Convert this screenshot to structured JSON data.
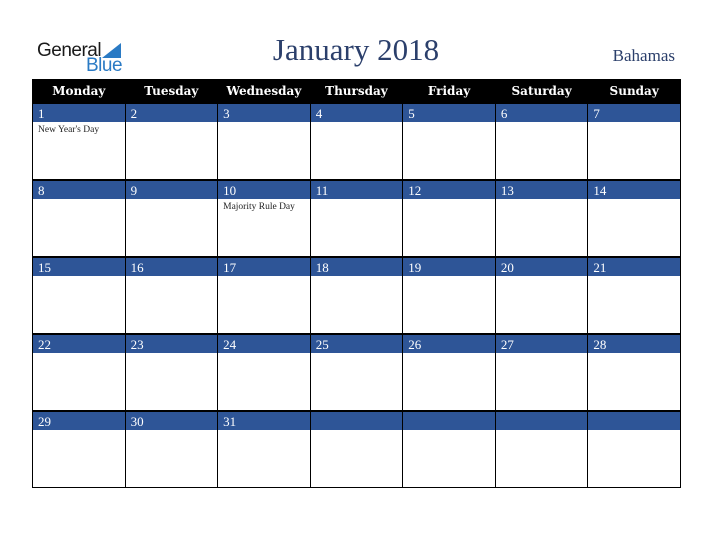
{
  "logo": {
    "line1": "General",
    "line2": "Blue"
  },
  "header": {
    "title": "January 2018",
    "country": "Bahamas"
  },
  "colors": {
    "header_bg": "#000000",
    "date_bar": "#2e5597",
    "title": "#2b3f6b",
    "logo_blue": "#2a7ac4"
  },
  "weekdays": [
    "Monday",
    "Tuesday",
    "Wednesday",
    "Thursday",
    "Friday",
    "Saturday",
    "Sunday"
  ],
  "weeks": [
    {
      "days": [
        "1",
        "2",
        "3",
        "4",
        "5",
        "6",
        "7"
      ],
      "events": [
        "New Year's Day",
        "",
        "",
        "",
        "",
        "",
        ""
      ]
    },
    {
      "days": [
        "8",
        "9",
        "10",
        "11",
        "12",
        "13",
        "14"
      ],
      "events": [
        "",
        "",
        "Majority Rule Day",
        "",
        "",
        "",
        ""
      ]
    },
    {
      "days": [
        "15",
        "16",
        "17",
        "18",
        "19",
        "20",
        "21"
      ],
      "events": [
        "",
        "",
        "",
        "",
        "",
        "",
        ""
      ]
    },
    {
      "days": [
        "22",
        "23",
        "24",
        "25",
        "26",
        "27",
        "28"
      ],
      "events": [
        "",
        "",
        "",
        "",
        "",
        "",
        ""
      ]
    },
    {
      "days": [
        "29",
        "30",
        "31",
        "",
        "",
        "",
        ""
      ],
      "events": [
        "",
        "",
        "",
        "",
        "",
        "",
        ""
      ]
    }
  ]
}
